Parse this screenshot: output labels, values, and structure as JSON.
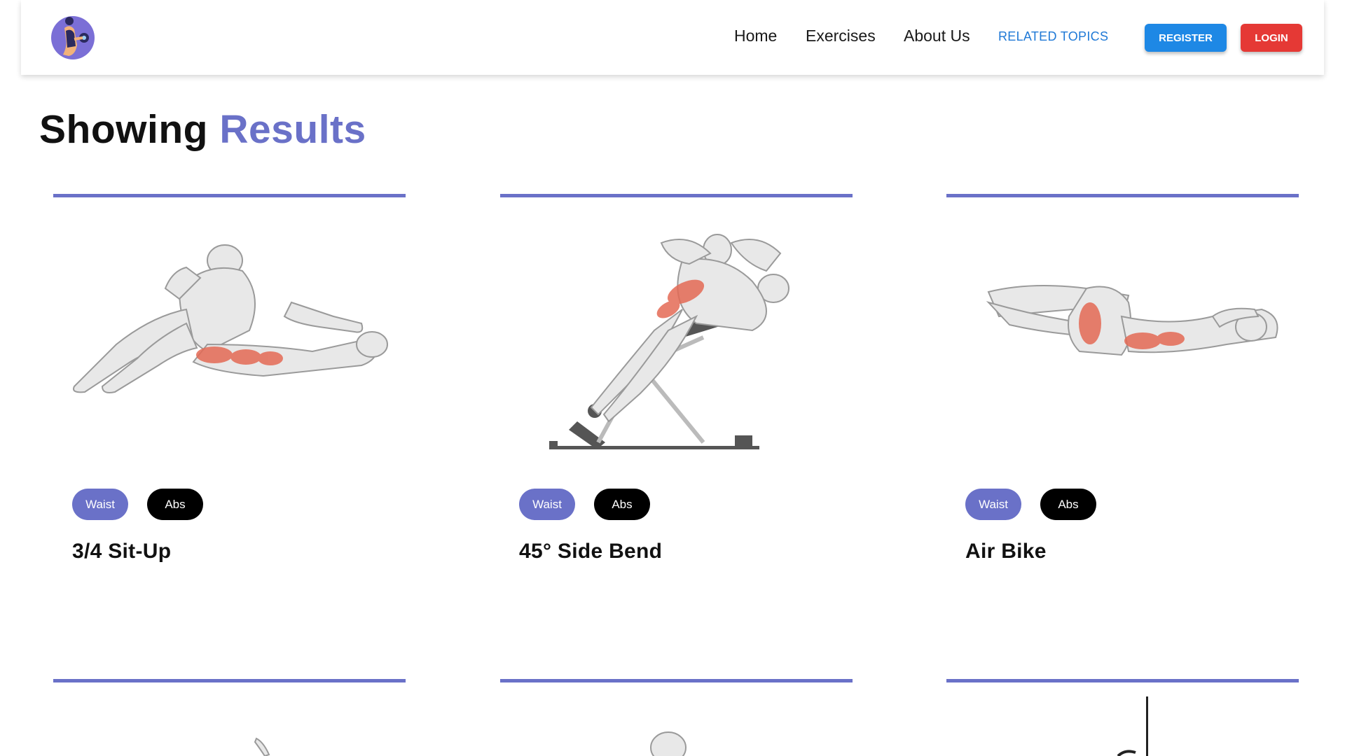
{
  "nav": {
    "links": [
      "Home",
      "Exercises",
      "About Us"
    ],
    "related": "RELATED TOPICS",
    "register": "REGISTER",
    "login": "LOGIN"
  },
  "heading": {
    "prefix": "Showing",
    "accent": "Results"
  },
  "colors": {
    "accent": "#6a71c8",
    "register": "#1e88e5",
    "login": "#e53935",
    "related": "#1f79d6"
  },
  "exercises": [
    {
      "tags": [
        "Waist",
        "Abs"
      ],
      "name": "3/4 Sit-Up",
      "image_icon": "sit-up-illustration"
    },
    {
      "tags": [
        "Waist",
        "Abs"
      ],
      "name": "45° Side Bend",
      "image_icon": "side-bend-illustration"
    },
    {
      "tags": [
        "Waist",
        "Abs"
      ],
      "name": "Air Bike",
      "image_icon": "air-bike-illustration"
    }
  ]
}
